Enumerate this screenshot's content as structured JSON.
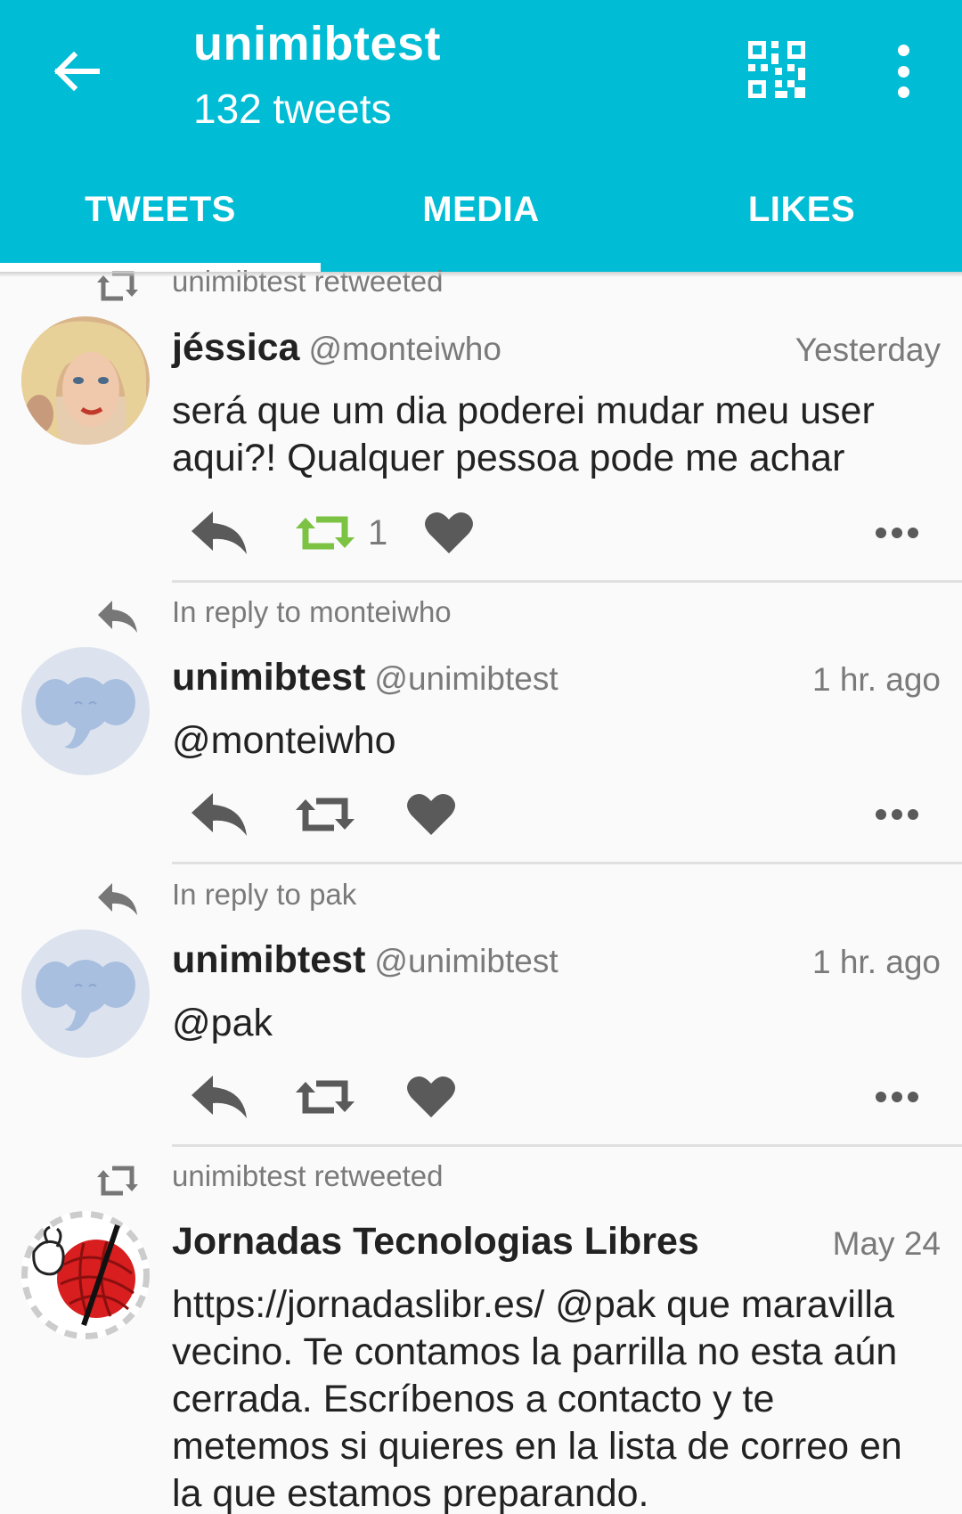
{
  "header": {
    "title": "unimibtest",
    "subtitle": "132 tweets",
    "tabs": [
      "TWEETS",
      "MEDIA",
      "LIKES"
    ],
    "active_tab": 0,
    "accent_color": "#00bcd4"
  },
  "icons": {
    "back": "arrow-left-icon",
    "qr": "qr-code-icon",
    "menu": "more-vert-icon",
    "reply": "reply-icon",
    "retweet": "retweet-icon",
    "like": "heart-icon",
    "more": "more-horiz-icon"
  },
  "tweets": [
    {
      "context": "unimibtest retweeted",
      "context_icon": "retweet-icon",
      "name": "jéssica",
      "handle": "@monteiwho",
      "time": "Yesterday",
      "text": "será que um dia poderei mudar meu user aqui?! Qualquer pessoa pode me achar",
      "retweet_count": "1",
      "retweeted": true,
      "retweet_color": "#7cc243"
    },
    {
      "context": "In reply to monteiwho",
      "context_icon": "reply-icon",
      "name": "unimibtest",
      "handle": "@unimibtest",
      "time": "1 hr. ago",
      "text": "@monteiwho",
      "retweet_count": ""
    },
    {
      "context": "In reply to pak",
      "context_icon": "reply-icon",
      "name": "unimibtest",
      "handle": "@unimibtest",
      "time": "1 hr. ago",
      "text": "@pak",
      "retweet_count": ""
    },
    {
      "context": "unimibtest retweeted",
      "context_icon": "retweet-icon",
      "name": "Jornadas Tecnologias Libres",
      "handle": "",
      "time": "May 24",
      "text": "https://jornadaslibr.es/ @pak que maravilla vecino. Te contamos la parrilla no esta aún cerrada. Escríbenos a contacto y te metemos si quieres en la lista de correo en la que estamos preparando."
    }
  ]
}
